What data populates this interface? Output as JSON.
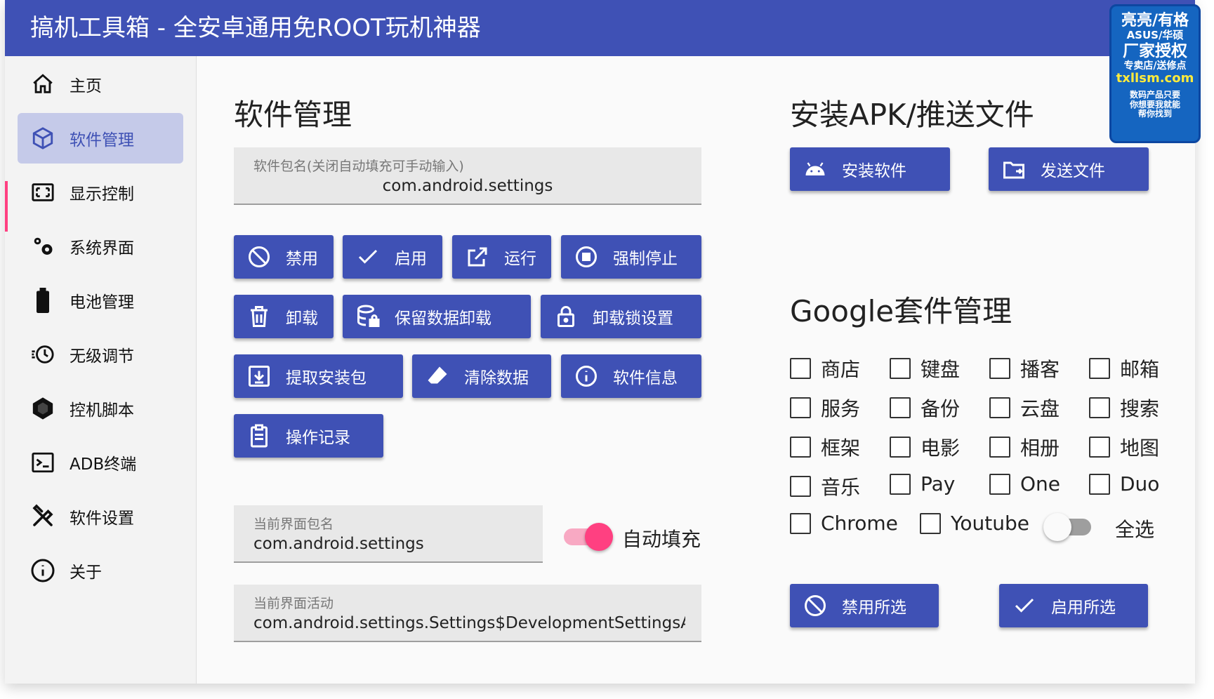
{
  "window": {
    "title": "搞机工具箱 - 全安卓通用免ROOT玩机神器"
  },
  "colors": {
    "primary": "#3f51b5",
    "accent": "#ff4081",
    "selected_bg": "#c5cae9"
  },
  "sidebar": {
    "items": [
      {
        "label": "主页",
        "icon": "home-icon"
      },
      {
        "label": "软件管理",
        "icon": "package-icon",
        "active": true
      },
      {
        "label": "显示控制",
        "icon": "display-icon"
      },
      {
        "label": "系统界面",
        "icon": "gears-icon"
      },
      {
        "label": "电池管理",
        "icon": "battery-icon"
      },
      {
        "label": "无级调节",
        "icon": "clock-adjust-icon"
      },
      {
        "label": "控机脚本",
        "icon": "hexagon-icon"
      },
      {
        "label": "ADB终端",
        "icon": "terminal-icon"
      },
      {
        "label": "软件设置",
        "icon": "tools-icon"
      },
      {
        "label": "关于",
        "icon": "info-icon"
      }
    ]
  },
  "software": {
    "title": "软件管理",
    "package_field": {
      "label": "软件包名(关闭自动填充可手动输入)",
      "value": "com.android.settings"
    },
    "buttons": [
      {
        "label": "禁用",
        "icon": "block-icon"
      },
      {
        "label": "启用",
        "icon": "check-icon"
      },
      {
        "label": "运行",
        "icon": "open-external-icon"
      },
      {
        "label": "强制停止",
        "icon": "stop-circle-icon"
      },
      {
        "label": "卸载",
        "icon": "trash-icon"
      },
      {
        "label": "保留数据卸载",
        "icon": "database-lock-icon"
      },
      {
        "label": "卸载锁设置",
        "icon": "lock-icon"
      },
      {
        "label": "提取安装包",
        "icon": "download-box-icon"
      },
      {
        "label": "清除数据",
        "icon": "eraser-icon"
      },
      {
        "label": "软件信息",
        "icon": "info-circle-icon"
      },
      {
        "label": "操作记录",
        "icon": "clipboard-icon"
      }
    ],
    "current_package": {
      "label": "当前界面包名",
      "value": "com.android.settings"
    },
    "autofill": {
      "label": "自动填充",
      "on": true
    },
    "current_activity": {
      "label": "当前界面活动",
      "value": "com.android.settings.Settings$DevelopmentSettingsActivity"
    }
  },
  "install": {
    "title": "安装APK/推送文件",
    "buttons": [
      {
        "label": "安装软件",
        "icon": "android-icon"
      },
      {
        "label": "发送文件",
        "icon": "folder-send-icon"
      }
    ]
  },
  "google": {
    "title": "Google套件管理",
    "checkboxes": [
      "商店",
      "键盘",
      "播客",
      "邮箱",
      "服务",
      "备份",
      "云盘",
      "搜索",
      "框架",
      "电影",
      "相册",
      "地图",
      "音乐",
      "Pay",
      "One",
      "Duo",
      "Chrome",
      "Youtube"
    ],
    "select_all": {
      "label": "全选",
      "on": false
    },
    "buttons": [
      {
        "label": "禁用所选",
        "icon": "block-icon"
      },
      {
        "label": "启用所选",
        "icon": "check-icon"
      }
    ]
  },
  "badge": {
    "lines": [
      "亮亮/有格",
      "ASUS/华硕",
      "厂家授权",
      "专卖店/送修点",
      "txllsm.com",
      "数码产品只要",
      "你想要我就能",
      "帮你找到"
    ]
  }
}
